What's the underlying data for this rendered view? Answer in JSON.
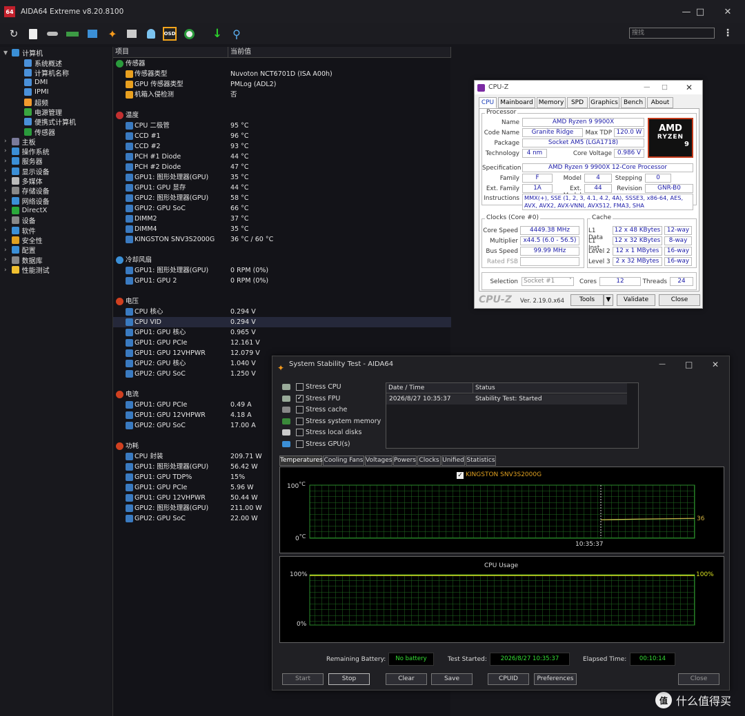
{
  "app": {
    "title": "AIDA64 Extreme v8.20.8100",
    "logo": "64"
  },
  "search": {
    "placeholder": "搜找"
  },
  "tree": {
    "computer": "计算机",
    "children": [
      "系统概述",
      "计算机名称",
      "DMI",
      "IPMI",
      "超频",
      "电源管理",
      "便携式计算机",
      "传感器"
    ],
    "items": [
      "主板",
      "操作系统",
      "服务器",
      "显示设备",
      "多媒体",
      "存储设备",
      "网络设备",
      "DirectX",
      "设备",
      "软件",
      "安全性",
      "配置",
      "数据库",
      "性能测试"
    ]
  },
  "list": {
    "col_item": "项目",
    "col_value": "当前值",
    "sensor_section": "传感器",
    "sensor_rows": [
      {
        "n": "传感器类型",
        "v": "Nuvoton NCT6701D  (ISA A00h)"
      },
      {
        "n": "GPU 传感器类型",
        "v": "PMLog  (ADL2)"
      },
      {
        "n": "机箱入侵检测",
        "v": "否"
      }
    ],
    "temp_section": "温度",
    "temp_rows": [
      {
        "n": "CPU 二极管",
        "v": "95 °C"
      },
      {
        "n": "CCD #1",
        "v": "96 °C"
      },
      {
        "n": "CCD #2",
        "v": "93 °C"
      },
      {
        "n": "PCH #1 Diode",
        "v": "44 °C"
      },
      {
        "n": "PCH #2 Diode",
        "v": "47 °C"
      },
      {
        "n": "GPU1: 图形处理器(GPU)",
        "v": "35 °C"
      },
      {
        "n": "GPU1: GPU 显存",
        "v": "44 °C"
      },
      {
        "n": "GPU2: 图形处理器(GPU)",
        "v": "58 °C"
      },
      {
        "n": "GPU2: GPU SoC",
        "v": "66 °C"
      },
      {
        "n": "DIMM2",
        "v": "37 °C"
      },
      {
        "n": "DIMM4",
        "v": "35 °C"
      },
      {
        "n": "KINGSTON SNV3S2000G",
        "v": "36 °C / 60 °C"
      }
    ],
    "fan_section": "冷却风扇",
    "fan_rows": [
      {
        "n": "GPU1: 图形处理器(GPU)",
        "v": "0 RPM  (0%)"
      },
      {
        "n": "GPU1: GPU 2",
        "v": "0 RPM  (0%)"
      }
    ],
    "volt_section": "电压",
    "volt_rows": [
      {
        "n": "CPU 核心",
        "v": "0.294 V"
      },
      {
        "n": "CPU VID",
        "v": "0.294 V"
      },
      {
        "n": "GPU1: GPU 核心",
        "v": "0.965 V"
      },
      {
        "n": "GPU1: GPU PCIe",
        "v": "12.161 V"
      },
      {
        "n": "GPU1: GPU 12VHPWR",
        "v": "12.079 V"
      },
      {
        "n": "GPU2: GPU 核心",
        "v": "1.040 V"
      },
      {
        "n": "GPU2: GPU SoC",
        "v": "1.250 V"
      }
    ],
    "curr_section": "电流",
    "curr_rows": [
      {
        "n": "GPU1: GPU PCIe",
        "v": "0.49 A"
      },
      {
        "n": "GPU1: GPU 12VHPWR",
        "v": "4.18 A"
      },
      {
        "n": "GPU2: GPU SoC",
        "v": "17.00 A"
      }
    ],
    "pow_section": "功耗",
    "pow_rows": [
      {
        "n": "CPU 封装",
        "v": "209.71 W"
      },
      {
        "n": "GPU1: 图形处理器(GPU)",
        "v": "56.42 W"
      },
      {
        "n": "GPU1: GPU TDP%",
        "v": "15%"
      },
      {
        "n": "GPU1: GPU PCIe",
        "v": "5.96 W"
      },
      {
        "n": "GPU1: GPU 12VHPWR",
        "v": "50.44 W"
      },
      {
        "n": "GPU2: 图形处理器(GPU)",
        "v": "211.00 W"
      },
      {
        "n": "GPU2: GPU SoC",
        "v": "22.00 W"
      }
    ]
  },
  "cpuz": {
    "title": "CPU-Z",
    "tabs": [
      "CPU",
      "Mainboard",
      "Memory",
      "SPD",
      "Graphics",
      "Bench",
      "About"
    ],
    "processor": "Processor",
    "name_l": "Name",
    "name": "AMD Ryzen 9 9900X",
    "codename_l": "Code Name",
    "codename": "Granite Ridge",
    "maxtdp_l": "Max TDP",
    "maxtdp": "120.0 W",
    "package_l": "Package",
    "package": "Socket AM5 (LGA1718)",
    "tech_l": "Technology",
    "tech": "4 nm",
    "corev_l": "Core Voltage",
    "corev": "0.986 V",
    "spec_l": "Specification",
    "spec": "AMD Ryzen 9 9900X 12-Core Processor",
    "family_l": "Family",
    "family": "F",
    "model_l": "Model",
    "model": "4",
    "stepping_l": "Stepping",
    "stepping": "0",
    "extfam_l": "Ext. Family",
    "extfam": "1A",
    "extmodel_l": "Ext. Model",
    "extmodel": "44",
    "revision_l": "Revision",
    "revision": "GNR-B0",
    "instr_l": "Instructions",
    "instr": "MMX(+), SSE (1, 2, 3, 4.1, 4.2, 4A), SSSE3, x86-64, AES, AVX, AVX2, AVX-VNNI, AVX512, FMA3, SHA",
    "clocks": "Clocks (Core #0)",
    "corespeed_l": "Core Speed",
    "corespeed": "4449.38 MHz",
    "mult_l": "Multiplier",
    "mult": "x44.5 (6.0 - 56.5)",
    "bus_l": "Bus Speed",
    "bus": "99.99 MHz",
    "fsb_l": "Rated FSB",
    "cache": "Cache",
    "l1d_l": "L1 Data",
    "l1d": "12 x 48 KBytes",
    "l1d_w": "12-way",
    "l1i_l": "L1 Inst.",
    "l1i": "12 x 32 KBytes",
    "l1i_w": "8-way",
    "l2_l": "Level 2",
    "l2": "12 x 1 MBytes",
    "l2_w": "16-way",
    "l3_l": "Level 3",
    "l3": "2 x 32 MBytes",
    "l3_w": "16-way",
    "sel_l": "Selection",
    "sel": "Socket #1",
    "cores_l": "Cores",
    "cores": "12",
    "threads_l": "Threads",
    "threads": "24",
    "brand": "CPU-Z",
    "ver": "Ver. 2.19.0.x64",
    "tools": "Tools",
    "validate": "Validate",
    "close": "Close",
    "amd1": "AMD",
    "amd2": "RYZEN",
    "amd3": "9"
  },
  "sst": {
    "title": "System Stability Test - AIDA64",
    "checks": [
      {
        "t": "Stress CPU",
        "c": ""
      },
      {
        "t": "Stress FPU",
        "c": "✓"
      },
      {
        "t": "Stress cache",
        "c": ""
      },
      {
        "t": "Stress system memory",
        "c": ""
      },
      {
        "t": "Stress local disks",
        "c": ""
      },
      {
        "t": "Stress GPU(s)",
        "c": ""
      }
    ],
    "log_h1": "Date / Time",
    "log_h2": "Status",
    "log_time": "2026/8/27 10:35:37",
    "log_status": "Stability Test: Started",
    "tabs": [
      "Temperatures",
      "Cooling Fans",
      "Voltages",
      "Powers",
      "Clocks",
      "Unified",
      "Statistics"
    ],
    "g1_legend": "KINGSTON SNV3S2000G",
    "g1_top": "100",
    "g1_bot": "0",
    "g1_unit": "°C",
    "g1_time": "10:35:37",
    "g1_val": "36",
    "g2_title": "CPU Usage",
    "g2_top": "100%",
    "g2_bot": "0%",
    "g2_val": "100%",
    "battery_l": "Remaining Battery:",
    "battery": "No battery",
    "started_l": "Test Started:",
    "started": "2026/8/27 10:35:37",
    "elapsed_l": "Elapsed Time:",
    "elapsed": "00:10:14",
    "start": "Start",
    "stop": "Stop",
    "clear": "Clear",
    "save": "Save",
    "cpuid": "CPUID",
    "prefs": "Preferences",
    "close": "Close"
  },
  "watermark": "什么值得买"
}
